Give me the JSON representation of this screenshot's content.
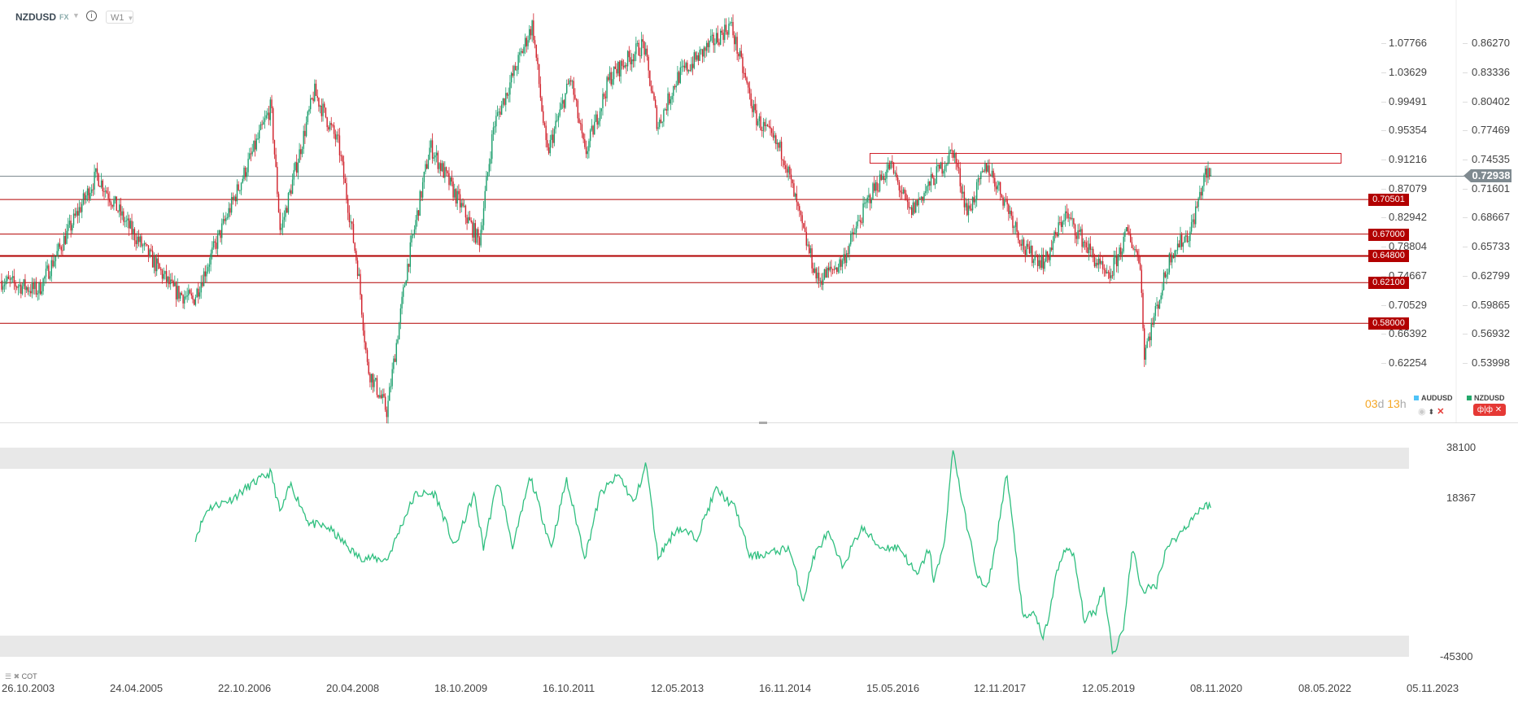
{
  "header": {
    "symbol": "NZDUSD",
    "market": "FX",
    "timeframe": "W1"
  },
  "left_axis": [
    "1.07766",
    "1.03629",
    "0.99491",
    "0.95354",
    "0.91216",
    "0.87079",
    "0.82942",
    "0.78804",
    "0.74667",
    "0.70529",
    "0.66392",
    "0.62254"
  ],
  "right_axis": [
    "0.86270",
    "0.83336",
    "0.80402",
    "0.77469",
    "0.74535",
    "0.71601",
    "0.68667",
    "0.65733",
    "0.62799",
    "0.59865",
    "0.56932",
    "0.53998"
  ],
  "current_price": "0.72938",
  "levels": [
    {
      "label": "0.70501",
      "value": 0.70501,
      "thick": false
    },
    {
      "label": "0.67000",
      "value": 0.67,
      "thick": false
    },
    {
      "label": "0.64800",
      "value": 0.648,
      "thick": true
    },
    {
      "label": "0.62100",
      "value": 0.621,
      "thick": false
    },
    {
      "label": "0.58000",
      "value": 0.58,
      "thick": false
    }
  ],
  "timer": {
    "days": "03",
    "d": "d",
    "hours": "13",
    "h": "h"
  },
  "legend": {
    "series1": "AUDUSD",
    "series2": "NZDUSD"
  },
  "colors": {
    "up": "#1b9e6c",
    "down": "#d0202a",
    "level": "#b20000",
    "cot": "#2fbf7f",
    "audusd": "#4fc3f7",
    "nzdusd": "#23a86b"
  },
  "indicator": {
    "name": "COT",
    "axis": [
      "38100",
      "18367",
      "-45300"
    ]
  },
  "dates": [
    "26.10.2003",
    "24.04.2005",
    "22.10.2006",
    "20.04.2008",
    "18.10.2009",
    "16.10.2011",
    "12.05.2013",
    "16.11.2014",
    "15.05.2016",
    "12.11.2017",
    "12.05.2019",
    "08.11.2020",
    "08.05.2022",
    "05.11.2023"
  ],
  "chart_data": [
    {
      "type": "candlestick",
      "title": "NZDUSD W1",
      "ylim": [
        0.52,
        0.87
      ],
      "anchors": [
        [
          2003.82,
          0.623
        ],
        [
          2004.33,
          0.613
        ],
        [
          2005.14,
          0.73
        ],
        [
          2005.54,
          0.682
        ],
        [
          2006.21,
          0.613
        ],
        [
          2006.48,
          0.603
        ],
        [
          2007.02,
          0.701
        ],
        [
          2007.56,
          0.799
        ],
        [
          2007.69,
          0.672
        ],
        [
          2008.16,
          0.814
        ],
        [
          2008.5,
          0.76
        ],
        [
          2008.77,
          0.633
        ],
        [
          2008.9,
          0.535
        ],
        [
          2009.17,
          0.491
        ],
        [
          2009.44,
          0.633
        ],
        [
          2009.77,
          0.759
        ],
        [
          2010.11,
          0.711
        ],
        [
          2010.45,
          0.662
        ],
        [
          2010.65,
          0.779
        ],
        [
          2011.19,
          0.882
        ],
        [
          2011.39,
          0.75
        ],
        [
          2011.72,
          0.828
        ],
        [
          2011.92,
          0.75
        ],
        [
          2012.26,
          0.828
        ],
        [
          2012.73,
          0.862
        ],
        [
          2012.93,
          0.779
        ],
        [
          2013.2,
          0.828
        ],
        [
          2013.74,
          0.867
        ],
        [
          2013.94,
          0.882
        ],
        [
          2014.28,
          0.789
        ],
        [
          2014.68,
          0.75
        ],
        [
          2014.95,
          0.672
        ],
        [
          2015.15,
          0.623
        ],
        [
          2015.49,
          0.642
        ],
        [
          2015.89,
          0.711
        ],
        [
          2016.16,
          0.74
        ],
        [
          2016.43,
          0.691
        ],
        [
          2017.03,
          0.755
        ],
        [
          2017.23,
          0.691
        ],
        [
          2017.5,
          0.74
        ],
        [
          2017.77,
          0.701
        ],
        [
          2018.04,
          0.652
        ],
        [
          2018.31,
          0.642
        ],
        [
          2018.58,
          0.691
        ],
        [
          2018.85,
          0.662
        ],
        [
          2019.18,
          0.623
        ],
        [
          2019.45,
          0.672
        ],
        [
          2019.63,
          0.642
        ],
        [
          2019.68,
          0.549
        ],
        [
          2019.85,
          0.594
        ],
        [
          2020.06,
          0.652
        ],
        [
          2020.32,
          0.672
        ],
        [
          2020.53,
          0.73
        ],
        [
          2020.62,
          0.7294
        ]
      ]
    },
    {
      "type": "line",
      "title": "COT",
      "ylim": [
        -45300,
        38100
      ],
      "points": [
        [
          2006.51,
          2234
        ],
        [
          2006.68,
          13820
        ],
        [
          2007.02,
          17680
        ],
        [
          2007.29,
          23475
        ],
        [
          2007.56,
          28110
        ],
        [
          2007.69,
          11890
        ],
        [
          2007.83,
          23475
        ],
        [
          2008.09,
          8030
        ],
        [
          2008.36,
          6100
        ],
        [
          2008.77,
          -5490
        ],
        [
          2009.17,
          -6650
        ],
        [
          2009.44,
          11890
        ],
        [
          2009.57,
          19610
        ],
        [
          2009.84,
          19610
        ],
        [
          2010.11,
          -1700
        ],
        [
          2010.38,
          19610
        ],
        [
          2010.51,
          -1700
        ],
        [
          2010.71,
          25400
        ],
        [
          2010.92,
          -1700
        ],
        [
          2011.16,
          26570
        ],
        [
          2011.45,
          -1700
        ],
        [
          2011.66,
          25400
        ],
        [
          2011.92,
          -5490
        ],
        [
          2012.13,
          19610
        ],
        [
          2012.39,
          27340
        ],
        [
          2012.6,
          15750
        ],
        [
          2012.77,
          31970
        ],
        [
          2012.93,
          -5560
        ],
        [
          2013.2,
          6100
        ],
        [
          2013.47,
          2234
        ],
        [
          2013.74,
          21550
        ],
        [
          2014.01,
          13820
        ],
        [
          2014.21,
          -5490
        ],
        [
          2014.55,
          -3560
        ],
        [
          2014.75,
          -1700
        ],
        [
          2014.95,
          -22870
        ],
        [
          2015.09,
          -5560
        ],
        [
          2015.29,
          4165
        ],
        [
          2015.49,
          -9350
        ],
        [
          2015.76,
          6100
        ],
        [
          2016.02,
          -1700
        ],
        [
          2016.29,
          -1700
        ],
        [
          2016.53,
          -13210
        ],
        [
          2016.7,
          -1700
        ],
        [
          2016.76,
          -15145
        ],
        [
          2016.9,
          -1700
        ],
        [
          2017.03,
          37770
        ],
        [
          2017.16,
          15750
        ],
        [
          2017.37,
          -13210
        ],
        [
          2017.5,
          -19000
        ],
        [
          2017.64,
          2234
        ],
        [
          2017.77,
          28110
        ],
        [
          2017.91,
          -5560
        ],
        [
          2018.0,
          -30600
        ],
        [
          2018.17,
          -27500
        ],
        [
          2018.27,
          -39100
        ],
        [
          2018.38,
          -26700
        ],
        [
          2018.44,
          -15145
        ],
        [
          2018.58,
          -1700
        ],
        [
          2018.71,
          -5560
        ],
        [
          2018.85,
          -30600
        ],
        [
          2019.02,
          -26700
        ],
        [
          2019.12,
          -17080
        ],
        [
          2019.25,
          -44500
        ],
        [
          2019.39,
          -34460
        ],
        [
          2019.52,
          -1700
        ],
        [
          2019.65,
          -19000
        ],
        [
          2019.85,
          -17080
        ],
        [
          2019.99,
          -1700
        ],
        [
          2020.19,
          4165
        ],
        [
          2020.46,
          13820
        ],
        [
          2020.62,
          15750
        ]
      ]
    }
  ]
}
